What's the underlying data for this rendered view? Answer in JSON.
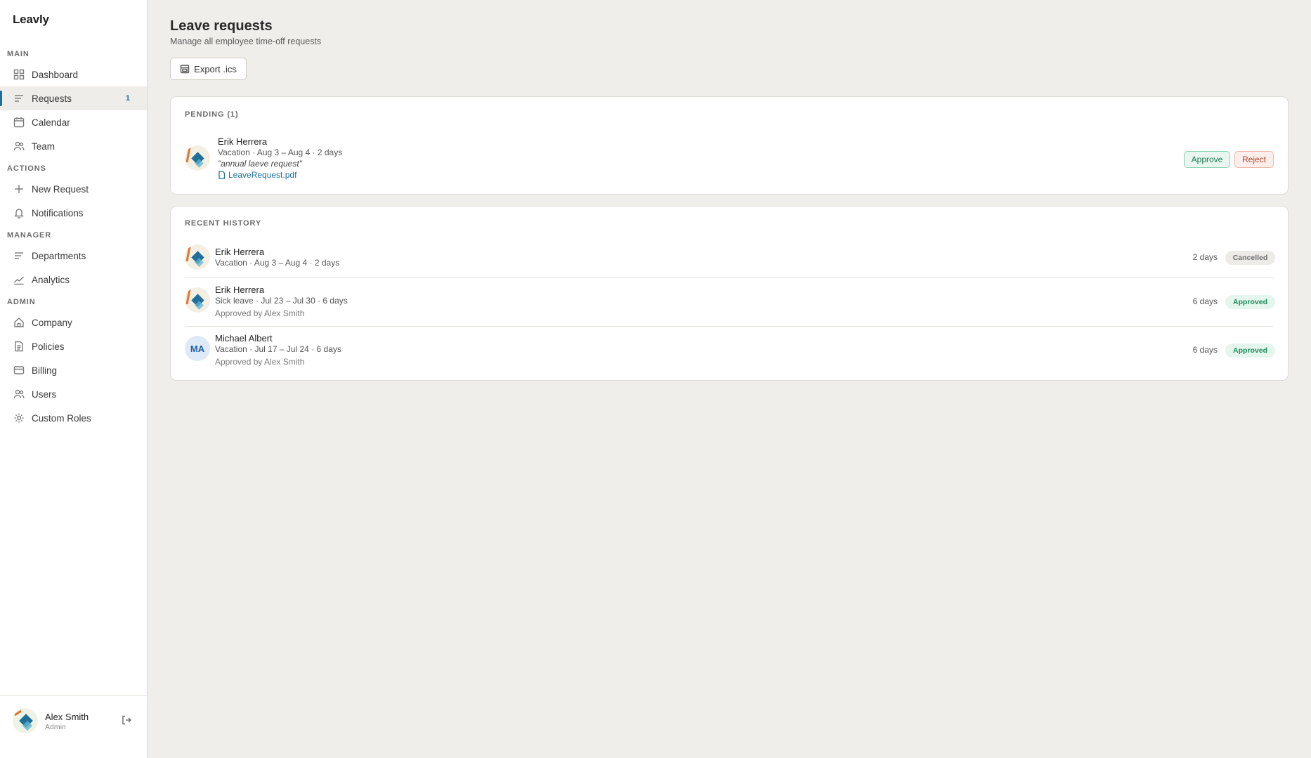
{
  "app": {
    "brand": "Leavly"
  },
  "sidebar": {
    "sections": [
      {
        "label": "MAIN"
      },
      {
        "label": "ACTIONS"
      },
      {
        "label": "MANAGER"
      },
      {
        "label": "ADMIN"
      }
    ],
    "items": [
      {
        "label": "Dashboard",
        "icon": "grid-icon"
      },
      {
        "label": "Requests",
        "icon": "list-icon",
        "badge": "1",
        "active": true
      },
      {
        "label": "Calendar",
        "icon": "calendar-icon"
      },
      {
        "label": "Team",
        "icon": "users-icon"
      },
      {
        "label": "New Request",
        "icon": "plus-icon"
      },
      {
        "label": "Notifications",
        "icon": "bell-icon"
      },
      {
        "label": "Departments",
        "icon": "list-icon"
      },
      {
        "label": "Analytics",
        "icon": "chart-icon"
      },
      {
        "label": "Company",
        "icon": "home-icon"
      },
      {
        "label": "Policies",
        "icon": "document-icon"
      },
      {
        "label": "Billing",
        "icon": "card-icon"
      },
      {
        "label": "Users",
        "icon": "users-icon"
      },
      {
        "label": "Custom Roles",
        "icon": "gear-icon"
      }
    ],
    "user": {
      "name": "Alex Smith",
      "role": "Admin"
    }
  },
  "header": {
    "title": "Leave requests",
    "subtitle": "Manage all employee time-off requests",
    "export_label": "Export .ics"
  },
  "pending": {
    "title": "PENDING (1)",
    "items": [
      {
        "name": "Erik Herrera",
        "meta": "Vacation · Aug 3 – Aug 4 · 2 days",
        "note": "\"annual laeve request\"",
        "attachment": "LeaveRequest.pdf",
        "approve_label": "Approve",
        "reject_label": "Reject"
      }
    ]
  },
  "history": {
    "title": "RECENT HISTORY",
    "items": [
      {
        "name": "Erik Herrera",
        "meta": "Vacation · Aug 3 – Aug 4 · 2 days",
        "sub": "",
        "days": "2 days",
        "status": "Cancelled"
      },
      {
        "name": "Erik Herrera",
        "meta": "Sick leave · Jul 23 – Jul 30 · 6 days",
        "sub": "Approved by Alex Smith",
        "days": "6 days",
        "status": "Approved"
      },
      {
        "name": "Michael Albert",
        "initials": "MA",
        "meta": "Vacation · Jul 17 – Jul 24 · 6 days",
        "sub": "Approved by Alex Smith",
        "days": "6 days",
        "status": "Approved"
      }
    ]
  },
  "colors": {
    "accent": "#1f6f9a",
    "approved": "#1d8a5a",
    "reject": "#b3432a",
    "background": "#f0eeea"
  }
}
